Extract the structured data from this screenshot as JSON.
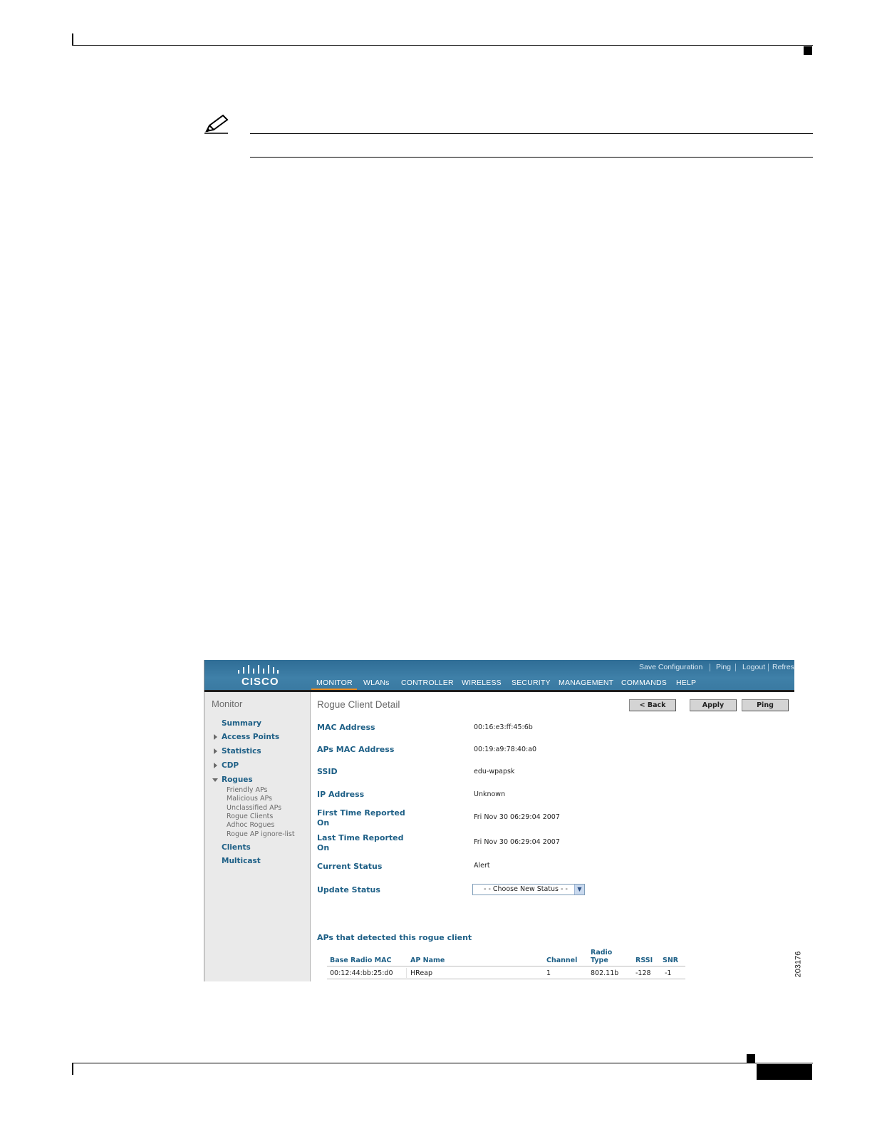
{
  "screenshot": {
    "brand": "CISCO",
    "top_links": [
      "Save Configuration",
      "Ping",
      "Logout",
      "Refres"
    ],
    "nav": [
      "MONITOR",
      "WLANs",
      "CONTROLLER",
      "WIRELESS",
      "SECURITY",
      "MANAGEMENT",
      "COMMANDS",
      "HELP"
    ],
    "active_nav": "MONITOR",
    "accent_color": "#e7891e",
    "sidebar": {
      "title": "Monitor",
      "items": [
        "Summary",
        "Access Points",
        "Statistics",
        "CDP",
        "Rogues",
        "Clients",
        "Multicast"
      ],
      "rogues_sub": [
        "Friendly APs",
        "Malicious APs",
        "Unclassified APs",
        "Rogue Clients",
        "Adhoc Rogues",
        "Rogue AP ignore-list"
      ]
    },
    "page_title": "Rogue Client Detail",
    "buttons": {
      "back": "< Back",
      "apply": "Apply",
      "ping": "Ping"
    },
    "fields": [
      {
        "label": "MAC Address",
        "value": "00:16:e3:ff:45:6b"
      },
      {
        "label": "APs MAC Address",
        "value": "00:19:a9:78:40:a0"
      },
      {
        "label": "SSID",
        "value": "edu-wpapsk"
      },
      {
        "label": "IP Address",
        "value": "Unknown"
      },
      {
        "label_line1": "First Time Reported",
        "label_line2": "On",
        "value": "Fri Nov 30 06:29:04 2007"
      },
      {
        "label_line1": "Last Time Reported",
        "label_line2": "On",
        "value": "Fri Nov 30 06:29:04 2007"
      },
      {
        "label": "Current Status",
        "value": "Alert"
      },
      {
        "label": "Update Status",
        "select_value": "- - Choose New Status - -"
      }
    ],
    "aps_section_title": "APs that detected this rogue client",
    "table": {
      "headers": [
        "Base Radio MAC",
        "AP Name",
        "Channel",
        "Radio",
        "Type",
        "RSSI",
        "SNR"
      ],
      "rows": [
        [
          "00:12:44:bb:25:d0",
          "HReap",
          "1",
          "802.11b",
          "-128",
          "-1"
        ]
      ]
    }
  },
  "figure_id": "203176"
}
